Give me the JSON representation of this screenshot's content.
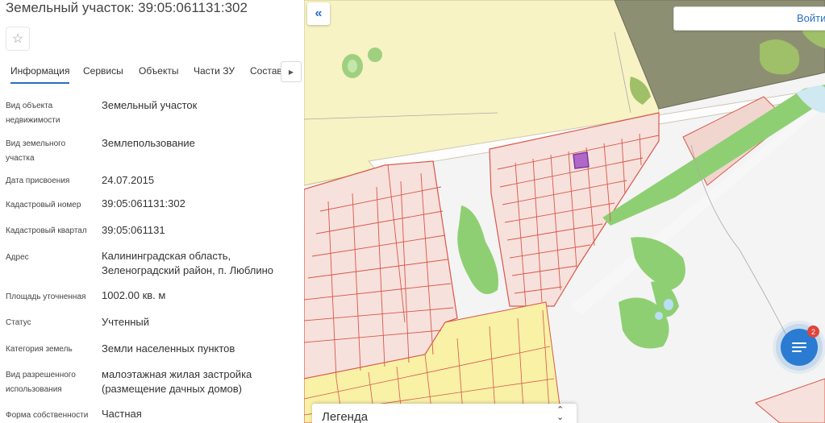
{
  "panel": {
    "title": "Земельный участок: 39:05:061131:302",
    "favorite_icon": "star-outline-icon",
    "tabs": [
      {
        "label": "Информация",
        "active": true
      },
      {
        "label": "Сервисы",
        "active": false
      },
      {
        "label": "Объекты",
        "active": false
      },
      {
        "label": "Части ЗУ",
        "active": false
      },
      {
        "label": "Состав",
        "active": false
      }
    ],
    "tabs_scroll_icon": "triangle-right-icon",
    "rows": [
      {
        "label": "Вид объекта недвижимости",
        "value": "Земельный участок"
      },
      {
        "label": "Вид земельного участка",
        "value": "Землепользование"
      },
      {
        "label": "Дата присвоения",
        "value": "24.07.2015"
      },
      {
        "label": "Кадастровый номер",
        "value": "39:05:061131:302"
      },
      {
        "label": "Кадастровый квартал",
        "value": "39:05:061131"
      },
      {
        "label": "Адрес",
        "value": "Калининградская область, Зеленоградский район, п. Люблино"
      },
      {
        "label": "Площадь уточненная",
        "value": "1002.00 кв. м"
      },
      {
        "label": "Статус",
        "value": "Учтенный"
      },
      {
        "label": "Категория земель",
        "value": "Земли населенных пунктов"
      },
      {
        "label": "Вид разрешенного использования",
        "value": "малоэтажная жилая застройка (размещение дачных домов)"
      },
      {
        "label": "Форма собственности",
        "value": "Частная"
      }
    ]
  },
  "map": {
    "collapse_icon": "double-chevron-left-icon",
    "login_label": "Войти",
    "legend_label": "Легенда",
    "legend_toggle_icon": "chevron-up-down-icon",
    "chat_icon": "chat-list-icon",
    "chat_badge": "2",
    "colors": {
      "agri_yellow": "#f7f3c4",
      "parcel_pink": "#f7e1dc",
      "parcel_border": "#d9574a",
      "village_yellow": "#f8f1a6",
      "forest_green": "#8fcf73",
      "forest_dark": "#8d8f72",
      "selected_parcel": "#b068c8"
    }
  }
}
